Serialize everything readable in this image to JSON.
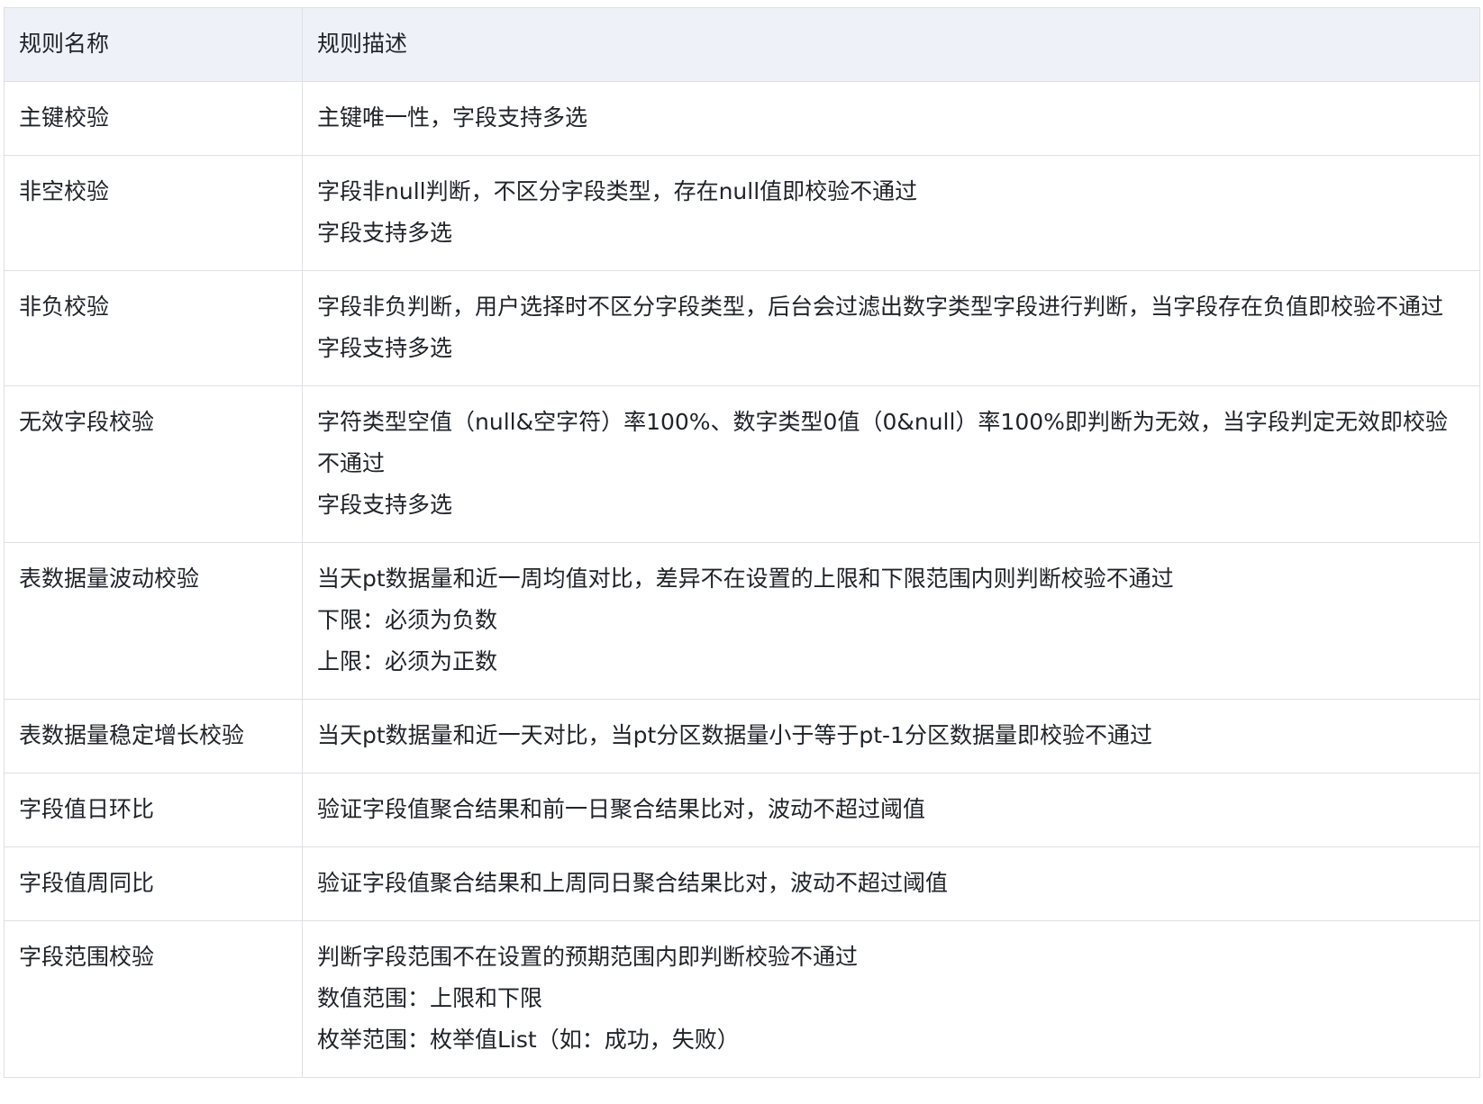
{
  "table": {
    "headers": [
      "规则名称",
      "规则描述"
    ],
    "rows": [
      {
        "name": "主键校验",
        "lines": [
          "主键唯一性，字段支持多选"
        ]
      },
      {
        "name": "非空校验",
        "lines": [
          "字段非null判断，不区分字段类型，存在null值即校验不通过",
          "字段支持多选"
        ]
      },
      {
        "name": "非负校验",
        "lines": [
          "字段非负判断，用户选择时不区分字段类型，后台会过滤出数字类型字段进行判断，当字段存在负值即校验不通过",
          "字段支持多选"
        ]
      },
      {
        "name": "无效字段校验",
        "lines": [
          "字符类型空值（null&空字符）率100%、数字类型0值（0&null）率100%即判断为无效，当字段判定无效即校验不通过",
          "字段支持多选"
        ]
      },
      {
        "name": "表数据量波动校验",
        "lines": [
          "当天pt数据量和近一周均值对比，差异不在设置的上限和下限范围内则判断校验不通过",
          "下限：必须为负数",
          "上限：必须为正数"
        ]
      },
      {
        "name": "表数据量稳定增长校验",
        "lines": [
          "当天pt数据量和近一天对比，当pt分区数据量小于等于pt-1分区数据量即校验不通过"
        ]
      },
      {
        "name": "字段值日环比",
        "lines": [
          "验证字段值聚合结果和前一日聚合结果比对，波动不超过阈值"
        ]
      },
      {
        "name": "字段值周同比",
        "lines": [
          "验证字段值聚合结果和上周同日聚合结果比对，波动不超过阈值"
        ]
      },
      {
        "name": "字段范围校验",
        "lines": [
          "判断字段范围不在设置的预期范围内即判断校验不通过",
          "数值范围：上限和下限",
          "枚举范围：枚举值List（如：成功，失败）"
        ]
      }
    ]
  }
}
